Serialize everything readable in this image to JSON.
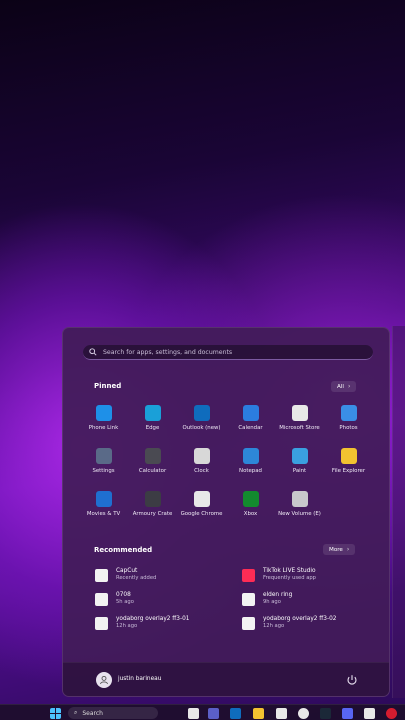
{
  "start_menu": {
    "search_placeholder": "Search for apps, settings, and documents",
    "pinned_title": "Pinned",
    "all_label": "All",
    "recommended_title": "Recommended",
    "more_label": "More",
    "pinned_apps": [
      {
        "label": "Phone Link",
        "icon": "phone-link-icon",
        "color": "#1e90e8"
      },
      {
        "label": "Edge",
        "icon": "edge-icon",
        "color": "#1aa0d8"
      },
      {
        "label": "Outlook (new)",
        "icon": "outlook-icon",
        "color": "#0f6cbd"
      },
      {
        "label": "Calendar",
        "icon": "calendar-icon",
        "color": "#2b7de0"
      },
      {
        "label": "Microsoft Store",
        "icon": "store-icon",
        "color": "#e8e8e8"
      },
      {
        "label": "Photos",
        "icon": "photos-icon",
        "color": "#3a8ee6"
      },
      {
        "label": "Settings",
        "icon": "gear-icon",
        "color": "#5a6a88"
      },
      {
        "label": "Calculator",
        "icon": "calculator-icon",
        "color": "#4a4a52"
      },
      {
        "label": "Clock",
        "icon": "clock-icon",
        "color": "#d8d8d8"
      },
      {
        "label": "Notepad",
        "icon": "notepad-icon",
        "color": "#2d87d8"
      },
      {
        "label": "Paint",
        "icon": "paint-icon",
        "color": "#3aa0e0"
      },
      {
        "label": "File Explorer",
        "icon": "folder-icon",
        "color": "#f2c230"
      },
      {
        "label": "Movies & TV",
        "icon": "movies-icon",
        "color": "#1f6fd0"
      },
      {
        "label": "Armoury Crate",
        "icon": "armoury-crate-icon",
        "color": "#3c3c44"
      },
      {
        "label": "Google Chrome",
        "icon": "chrome-icon",
        "color": "#e8e8e8"
      },
      {
        "label": "Xbox",
        "icon": "xbox-icon",
        "color": "#138a2e"
      },
      {
        "label": "New Volume (E)",
        "icon": "drive-icon",
        "color": "#c8c8cc"
      }
    ],
    "recommended": [
      {
        "title": "CapCut",
        "subtitle": "Recently added",
        "icon": "capcut-icon",
        "color": "#f2f2f2"
      },
      {
        "title": "TikTok LIVE Studio",
        "subtitle": "Frequently used app",
        "icon": "tiktok-icon",
        "color": "#fe2c55"
      },
      {
        "title": "0708",
        "subtitle": "5h ago",
        "icon": "video-file-icon",
        "color": "#f2f2f2"
      },
      {
        "title": "elden ring",
        "subtitle": "9h ago",
        "icon": "image-file-icon",
        "color": "#f2f2f2"
      },
      {
        "title": "yodaborg overlay2 ff3-01",
        "subtitle": "12h ago",
        "icon": "image-file-icon",
        "color": "#f2f2f2"
      },
      {
        "title": "yodaborg overlay2 ff3-02",
        "subtitle": "12h ago",
        "icon": "image-file-icon",
        "color": "#f2f2f2"
      }
    ],
    "user_name": "justin barineau"
  },
  "taskbar": {
    "search_label": "Search"
  }
}
